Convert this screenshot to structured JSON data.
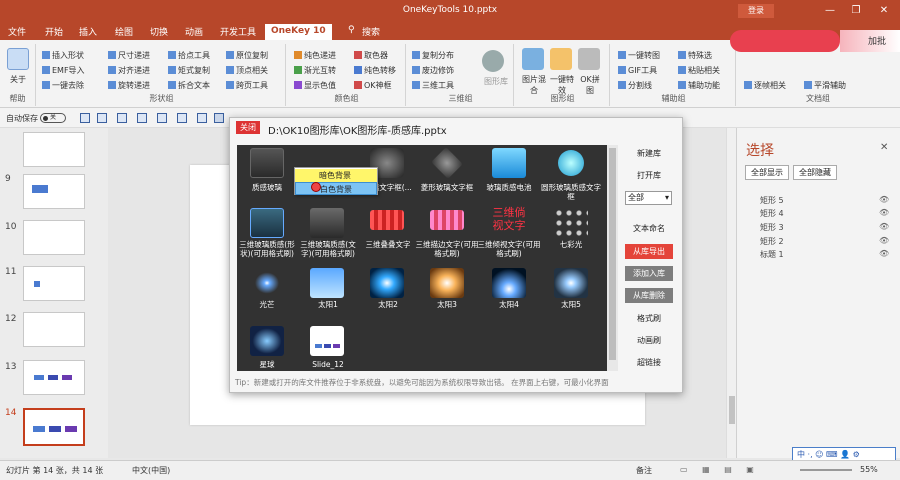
{
  "window": {
    "title": "OneKeyTools 10.pptx",
    "login": "登录",
    "minimize": "—",
    "restore": "❐",
    "close": "✕"
  },
  "tabs": [
    "文件",
    "开始",
    "插入",
    "绘图",
    "切换",
    "动画",
    "开发工具",
    "OneKey 10",
    "搜索"
  ],
  "active_tab": "OneKey 10",
  "ribbon": {
    "about": {
      "label": "关于",
      "group": "帮助"
    },
    "shape_group": {
      "name": "形状组",
      "items": [
        "插入形状",
        "尺寸递进",
        "拾点工具",
        "原位复制",
        "EMF导入",
        "对齐递进",
        "矩式复制",
        "顶点相关",
        "一键去除",
        "旋转递进",
        "拆合文本",
        "跨页工具"
      ]
    },
    "color_group": {
      "name": "颜色组",
      "items": [
        "纯色递进",
        "取色器",
        "渐光互转",
        "纯色转移",
        "显示色值",
        "OK神框"
      ]
    },
    "3d_group": {
      "name": "三维组",
      "items": [
        "复制分布",
        "废边修饰",
        "三维工具",
        "图形库"
      ]
    },
    "image_group": {
      "name": "图形组",
      "items": [
        "图片混合",
        "一键特效",
        "OK拼图"
      ]
    },
    "aux_group": {
      "name": "辅助组",
      "items": [
        "一键转图",
        "特殊选",
        "GIF工具",
        "粘贴相关",
        "分割线",
        "辅助功能"
      ]
    },
    "doc_group": {
      "name": "文档组",
      "items": [
        "逐帧相关",
        "平滑辅助"
      ]
    },
    "overlay_text": "加批"
  },
  "qat": {
    "autosave": "自动保存",
    "toggle": "关"
  },
  "thumbnails": [
    {
      "num": "9"
    },
    {
      "num": "10"
    },
    {
      "num": "11"
    },
    {
      "num": "12"
    },
    {
      "num": "13"
    },
    {
      "num": "14"
    }
  ],
  "dialog": {
    "close": "关闭",
    "path": "D:\\OK10图形库\\OK图形库-质感库.pptx",
    "items": [
      {
        "label": "质感玻璃"
      },
      {
        "label": "玻璃文字框(..."
      },
      {
        "label": "菱形玻璃文字框"
      },
      {
        "label": "玻璃质感电池"
      },
      {
        "label": "圆形玻璃质感文字框"
      },
      {
        "label": "三维玻璃质感(形状)(可用格式刷)"
      },
      {
        "label": "三维玻璃质感(文字)(可用格式刷)"
      },
      {
        "label": "三维叠叠文字"
      },
      {
        "label": "三维描边文字(可用格式刷)"
      },
      {
        "label": "三维倾视文字(可用格式刷)"
      },
      {
        "label": "七彩光"
      },
      {
        "label": "光芒"
      },
      {
        "label": "太阳1"
      },
      {
        "label": "太阳2"
      },
      {
        "label": "太阳3"
      },
      {
        "label": "太阳4"
      },
      {
        "label": "太阳5"
      },
      {
        "label": "星球"
      },
      {
        "label": "Slide_12"
      }
    ],
    "context_menu": [
      "暗色背景",
      "白色背景"
    ],
    "side_buttons": {
      "new_lib": "新建库",
      "open_lib": "打开库",
      "select": "全部",
      "rename": "文本命名",
      "export": "从库导出",
      "add": "添加入库",
      "delete": "从库删除",
      "format": "格式刷",
      "anim": "动画刷",
      "link": "超链接"
    },
    "thumb_text_1": "三维倘",
    "thumb_text_2": "视文字",
    "tip": "Tip：新建或打开的库文件推荐位于非系统盘，以避免可能因为系统权限导致出错。  在界面上右键，可最小化界面"
  },
  "right_panel": {
    "title": "选择",
    "show_all": "全部显示",
    "hide_all": "全部隐藏",
    "shapes": [
      "矩形 5",
      "矩形 4",
      "矩形 3",
      "矩形 2",
      "标题 1"
    ],
    "close": "✕"
  },
  "status": {
    "slide_info": "幻灯片 第 14 张，共 14 张",
    "lang": "中文(中国)",
    "notes": "备注",
    "zoom": "55%"
  },
  "ime": {
    "text": "中 ·, ☺ ⌨ 👤 ⚙"
  }
}
